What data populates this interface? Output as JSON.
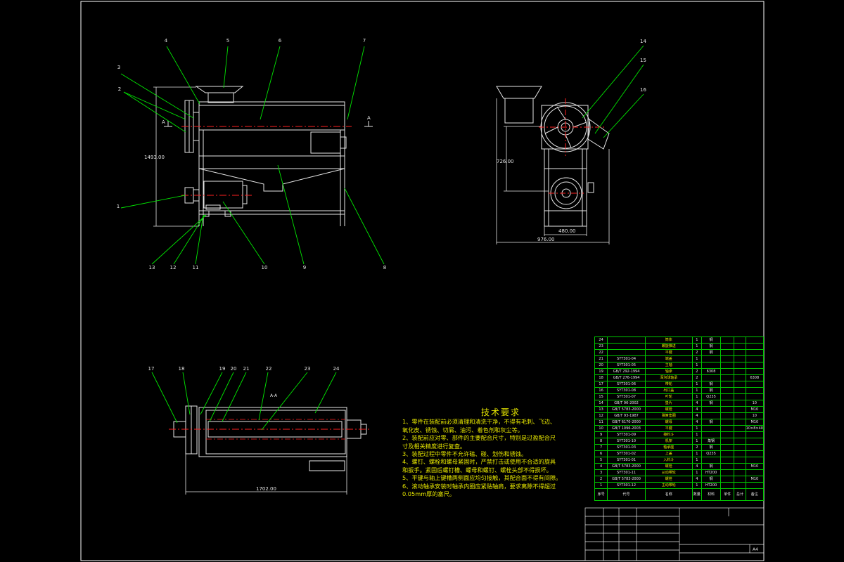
{
  "callouts": {
    "front": [
      "1",
      "2",
      "3",
      "4",
      "5",
      "6",
      "7",
      "8",
      "9",
      "10",
      "11",
      "12",
      "13"
    ],
    "side": [
      "14",
      "15",
      "16"
    ],
    "section": [
      "17",
      "18",
      "19",
      "20",
      "21",
      "22",
      "23",
      "24"
    ]
  },
  "dimensions": {
    "front_height": "1493.00",
    "side_height": "726.00",
    "side_inner_width": "480.00",
    "side_width": "976.00",
    "section_length": "1702.00",
    "section_marker": "A",
    "section_title": "A-A"
  },
  "technical_requirements": {
    "title": "技术要求",
    "lines": [
      "1、零件在装配前必须清理和清洗干净，不得有毛刺、飞边、",
      "氧化皮、锈蚀、切屑、油污、着色剂和灰尘等。",
      "2、装配前应对零、部件的主要配合尺寸，特别是过盈配合尺",
      "寸及相关精度进行复查。",
      "3、装配过程中零件不允许磕、碰、划伤和锈蚀。",
      "4、螺钉、螺栓和螺母紧固时，严禁打击或使用不合适的旋具",
      "和扳手。紧固后螺钉槽、螺母和螺钉、螺栓头部不得损坏。",
      "5、平键与轴上键槽两侧面应均匀接触，其配合面不得有间隙。",
      "6、滚动轴承安装时轴承内圈应紧贴轴肩，要求离隙不得超过",
      "0.05mm厚的塞尺。"
    ]
  },
  "bom": {
    "rows": [
      {
        "no": "24",
        "code": "",
        "name": "筒体",
        "qty": "1",
        "mat": "钢"
      },
      {
        "no": "23",
        "code": "",
        "name": "螺旋推进",
        "qty": "1",
        "mat": "钢"
      },
      {
        "no": "22",
        "code": "",
        "name": "平键",
        "qty": "2",
        "mat": "钢"
      },
      {
        "no": "21",
        "code": "SYT301-04",
        "name": "端盖",
        "qty": "1",
        "mat": ""
      },
      {
        "no": "20",
        "code": "SYT301-05",
        "name": "主轴",
        "qty": "1",
        "mat": ""
      },
      {
        "no": "19",
        "code": "GB/T 292-1994",
        "name": "轴承",
        "qty": "2",
        "mat": "6308"
      },
      {
        "no": "18",
        "code": "GB/T 276-1994",
        "name": "深沟球轴承",
        "qty": "2",
        "mat": "",
        "rem": "6308"
      },
      {
        "no": "17",
        "code": "SYT301-06",
        "name": "带轮",
        "qty": "1",
        "mat": "钢"
      },
      {
        "no": "16",
        "code": "SYT301-08",
        "name": "出口盖",
        "qty": "1",
        "mat": "钢"
      },
      {
        "no": "15",
        "code": "SYT301-07",
        "name": "叶轮",
        "qty": "1",
        "mat": "Q235"
      },
      {
        "no": "14",
        "code": "GB/T 96-2002",
        "name": "垫片",
        "qty": "4",
        "mat": "钢",
        "rem": "10"
      },
      {
        "no": "13",
        "code": "GB/T 5783-2000",
        "name": "螺栓",
        "qty": "4",
        "mat": "",
        "rem": "M10"
      },
      {
        "no": "12",
        "code": "GB/T 93-1987",
        "name": "弹簧垫圈",
        "qty": "4",
        "mat": "",
        "rem": "10"
      },
      {
        "no": "11",
        "code": "GB/T 6170-2000",
        "name": "螺母",
        "qty": "4",
        "mat": "钢",
        "rem": "M10"
      },
      {
        "no": "10",
        "code": "GB/T 1096-2003",
        "name": "平键",
        "qty": "1",
        "mat": "",
        "rem": "10×8×40"
      },
      {
        "no": "9",
        "code": "SYT301-09",
        "name": "接料斗",
        "qty": "1",
        "mat": ""
      },
      {
        "no": "8",
        "code": "SYT301-10",
        "name": "机架",
        "qty": "1",
        "mat": "角钢"
      },
      {
        "no": "7",
        "code": "SYT301-03",
        "name": "轴承座",
        "qty": "2",
        "mat": "钢"
      },
      {
        "no": "6",
        "code": "SYT301-02",
        "name": "上盖",
        "qty": "1",
        "mat": "Q235"
      },
      {
        "no": "5",
        "code": "SYT301-01",
        "name": "入料斗",
        "qty": "1",
        "mat": ""
      },
      {
        "no": "4",
        "code": "GB/T 5783-2000",
        "name": "螺栓",
        "qty": "4",
        "mat": "钢",
        "rem": "M10"
      },
      {
        "no": "3",
        "code": "SYT301-11",
        "name": "从动带轮",
        "qty": "1",
        "mat": "HT200"
      },
      {
        "no": "2",
        "code": "GB/T 5783-2000",
        "name": "螺栓",
        "qty": "4",
        "mat": "钢",
        "rem": "M10"
      },
      {
        "no": "1",
        "code": "SYT301-12",
        "name": "主动带轮",
        "qty": "1",
        "mat": "HT200"
      }
    ],
    "header": {
      "no": "序号",
      "code": "代号",
      "name": "名称",
      "qty": "数量",
      "mat": "材料",
      "w1": "单件",
      "w2": "总计",
      "rem": "备注"
    }
  },
  "title_block": {
    "sheet": "A4"
  },
  "colors": {
    "frame": "#ffffff",
    "outline": "#e6e6e6",
    "leader": "#00e600",
    "centerline": "#ff2020",
    "text_yellow": "#e6e600",
    "table_line": "#00c800"
  }
}
